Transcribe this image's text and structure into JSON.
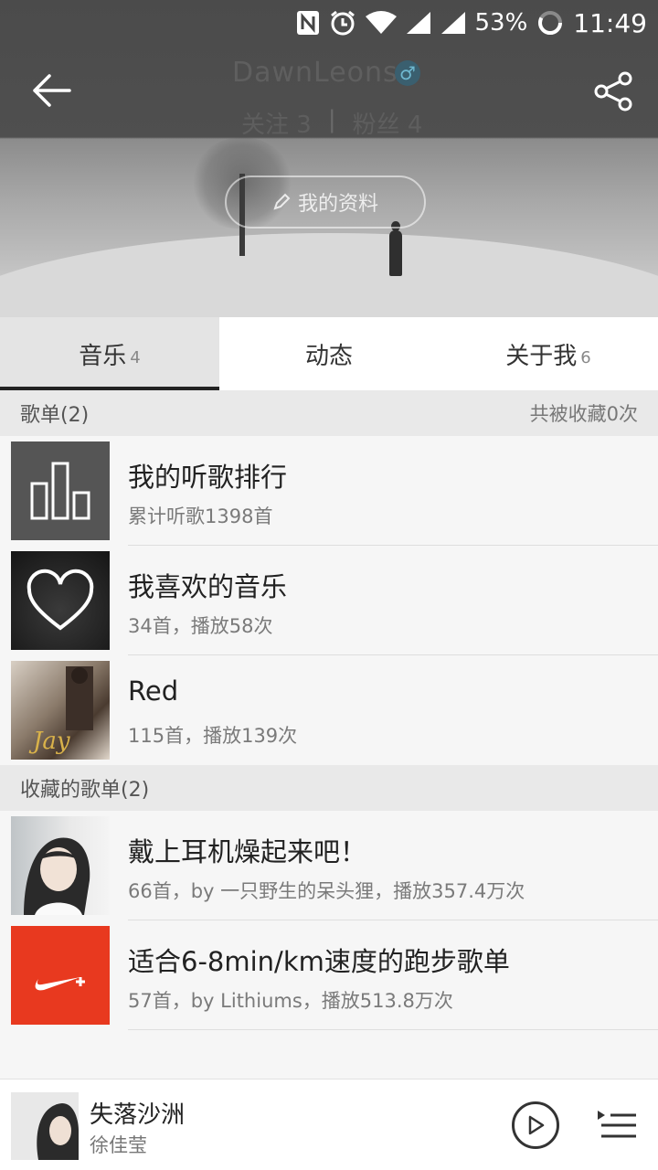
{
  "status": {
    "battery_percent": "53%",
    "time": "11:49"
  },
  "profile": {
    "username": "DawnLeons",
    "follow_text": "关注 3",
    "fans_text": "粉丝 4",
    "edit_profile_label": "我的资料"
  },
  "tabs": [
    {
      "label": "音乐",
      "count": "4",
      "active": true
    },
    {
      "label": "动态",
      "count": "",
      "active": false
    },
    {
      "label": "关于我",
      "count": "6",
      "active": false
    }
  ],
  "playlists_section": {
    "title": "歌单(2)",
    "right": "共被收藏0次"
  },
  "playlists": [
    {
      "title": "我的听歌排行",
      "sub": "累计听歌1398首",
      "icon": "bar-chart-icon"
    },
    {
      "title": "我喜欢的音乐",
      "sub": "34首，播放58次",
      "icon": "heart-icon"
    },
    {
      "title": "Red",
      "sub": "115首，播放139次",
      "icon": "album-cover"
    }
  ],
  "collected_section": {
    "title": "收藏的歌单(2)"
  },
  "collected": [
    {
      "title": "戴上耳机燥起来吧！",
      "sub": "66首，by 一只野生的呆头狸，播放357.4万次"
    },
    {
      "title": "适合6-8min/km速度的跑步歌单",
      "sub": "57首，by Lithiums，播放513.8万次"
    }
  ],
  "player": {
    "song": "失落沙洲",
    "artist": "徐佳莹"
  },
  "colors": {
    "nike_red": "#e8391f",
    "accent_gender": "#3a5f6f"
  }
}
